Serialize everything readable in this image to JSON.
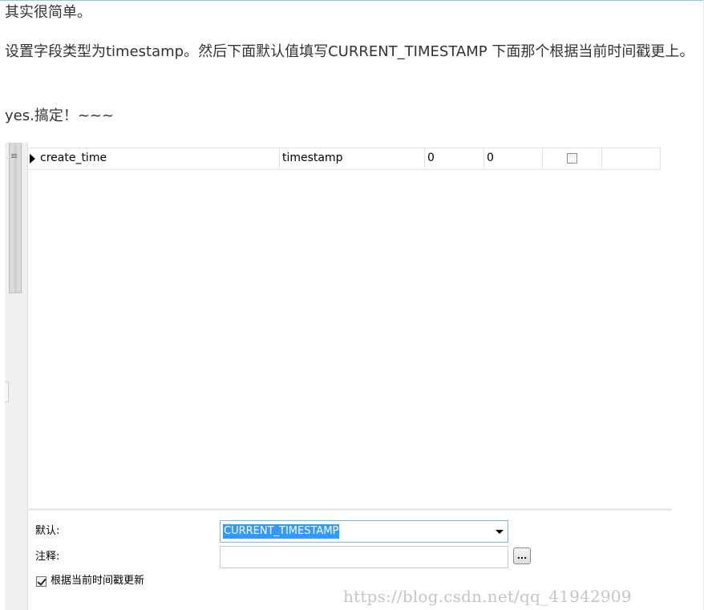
{
  "article": {
    "line1": "其实很简单。",
    "line2": "设置字段类型为timestamp。然后下面默认值填写CURRENT_TIMESTAMP 下面那个根据当前时间戳更上。",
    "line3": "yes.搞定！~~~"
  },
  "grid": {
    "row": {
      "name": "create_time",
      "type": "timestamp",
      "length": "0",
      "decimals": "0",
      "not_null_checked": false
    }
  },
  "properties": {
    "default_label": "默认:",
    "default_value": "CURRENT_TIMESTAMP",
    "comment_label": "注释:",
    "comment_value": "",
    "ellipsis_label": "...",
    "update_label": "根据当前时间戳更新",
    "update_checked": true
  },
  "watermark": "https://blog.csdn.net/qq_41942909",
  "colors": {
    "selection": "#3399ff",
    "focus_border": "#7eb4ea",
    "top_border": "#7fd0df"
  },
  "icons": [
    "row-pointer-icon",
    "menu-grip-icon",
    "dropdown-arrow-icon",
    "checkbox-icon"
  ]
}
